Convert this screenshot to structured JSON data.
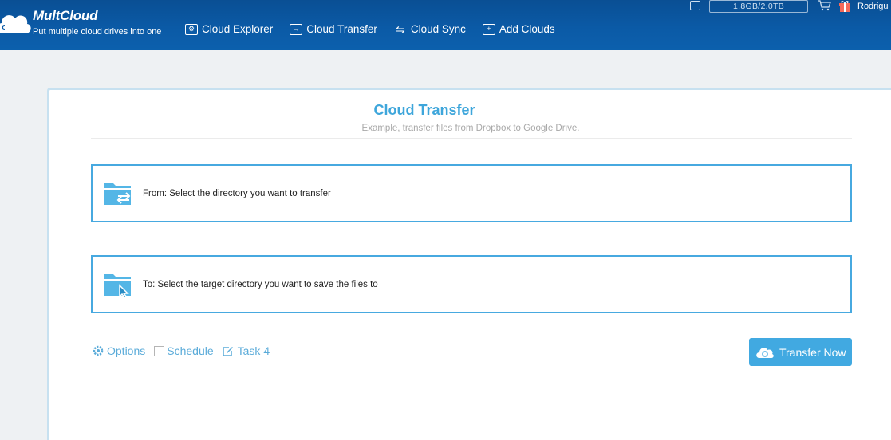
{
  "header": {
    "brand": "MultCloud",
    "tagline": "Put multiple cloud drives into one",
    "nav": [
      {
        "label": "Cloud Explorer",
        "icon": "explorer-icon"
      },
      {
        "label": "Cloud Transfer",
        "icon": "transfer-icon"
      },
      {
        "label": "Cloud Sync",
        "icon": "sync-icon"
      },
      {
        "label": "Add Clouds",
        "icon": "plus-icon"
      }
    ],
    "storage": "1.8GB/2.0TB",
    "user": "Rodrigu"
  },
  "main": {
    "title": "Cloud Transfer",
    "subtitle": "Example, transfer files from Dropbox to Google Drive.",
    "from_label": "From: Select the directory you want to transfer",
    "to_label": "To: Select the target directory you want to save the files to"
  },
  "actions": {
    "options": "Options",
    "schedule": "Schedule",
    "task": "Task 4",
    "transfer_now": "Transfer Now"
  },
  "colors": {
    "header": "#0b5aa6",
    "accent": "#41a9e1",
    "title": "#3ea6db"
  }
}
